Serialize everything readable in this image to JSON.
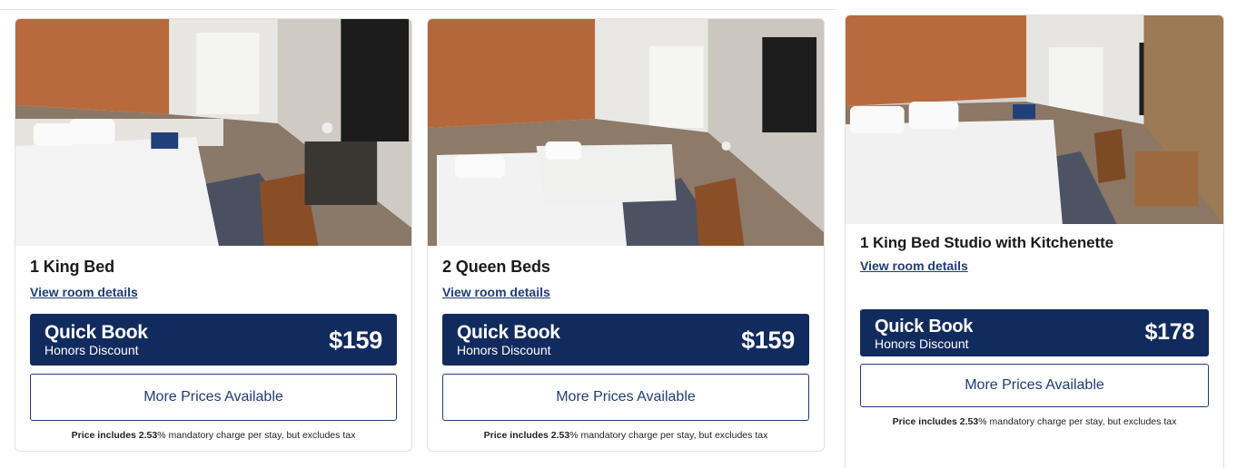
{
  "rooms": [
    {
      "name": "1 King Bed",
      "details_link": "View room details",
      "quick_book": {
        "title": "Quick Book",
        "rate": "Honors Discount",
        "price": "$159"
      },
      "more_prices": "More Prices Available",
      "note": {
        "bold": "Price includes 2.53",
        "rest": "% mandatory charge per stay, but excludes tax"
      }
    },
    {
      "name": "2 Queen Beds",
      "details_link": "View room details",
      "quick_book": {
        "title": "Quick Book",
        "rate": "Honors Discount",
        "price": "$159"
      },
      "more_prices": "More Prices Available",
      "note": {
        "bold": "Price includes 2.53",
        "rest": "% mandatory charge per stay, but excludes tax"
      }
    },
    {
      "name": "1 King Bed Studio with Kitchenette",
      "details_link": "View room details",
      "quick_book": {
        "title": "Quick Book",
        "rate": "Honors Discount",
        "price": "$178"
      },
      "more_prices": "More Prices Available",
      "note": {
        "bold": "Price includes 2.53",
        "rest": "% mandatory charge per stay, but excludes tax"
      }
    }
  ],
  "colors": {
    "brand_navy": "#122b5e",
    "link_blue": "#1f3c74",
    "wall_copper": "#b86a3e"
  },
  "icons": [
    "room-photo"
  ]
}
